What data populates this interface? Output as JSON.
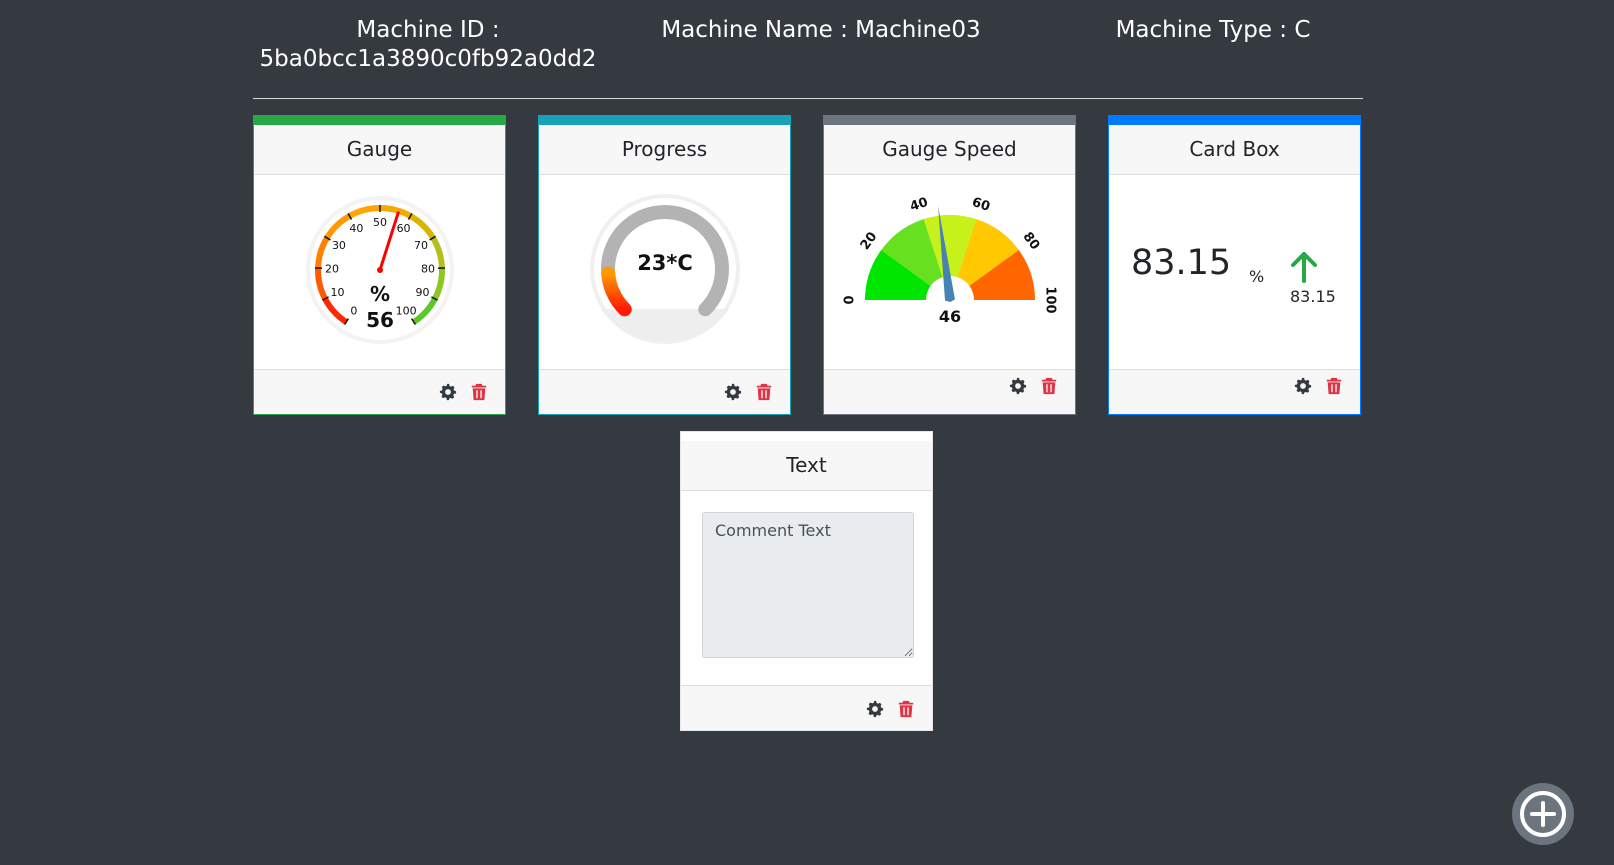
{
  "header": {
    "machine_id_label": "Machine ID :",
    "machine_id_value": "5ba0bcc1a3890c0fb92a0dd2",
    "machine_name": "Machine Name : Machine03",
    "machine_type": "Machine Type : C"
  },
  "cards": {
    "gauge": {
      "title": "Gauge",
      "accent": "#28a745",
      "unit": "%",
      "value": "56",
      "value_num": 56,
      "scale_min": 0,
      "scale_max": 100,
      "ticks": [
        "0",
        "10",
        "20",
        "30",
        "40",
        "50",
        "60",
        "70",
        "80",
        "90",
        "100"
      ]
    },
    "progress": {
      "title": "Progress",
      "accent": "#17a2b8",
      "value_text": "23*C",
      "fill_fraction": 0.15
    },
    "gauge_speed": {
      "title": "Gauge Speed",
      "accent": "#6c757d",
      "value": "46",
      "value_num": 46,
      "scale_min": 0,
      "scale_max": 100,
      "labels": [
        "0",
        "20",
        "40",
        "60",
        "80",
        "100"
      ],
      "segment_colors": [
        "#00e600",
        "#66e01f",
        "#c6f11a",
        "#ffc800",
        "#ff6600"
      ]
    },
    "card_box": {
      "title": "Card Box",
      "accent": "#007bff",
      "value": "83.15",
      "unit": "%",
      "trend_value": "83.15",
      "trend": "up",
      "trend_color": "#28a745",
      "trend_icon": "arrow-up-icon"
    },
    "text": {
      "title": "Text",
      "placeholder": "Comment Text"
    }
  },
  "icons": {
    "settings": "gear-icon",
    "delete": "trash-icon",
    "add": "plus-circle-icon",
    "delete_color": "#dc3545",
    "settings_color": "#343a40"
  }
}
